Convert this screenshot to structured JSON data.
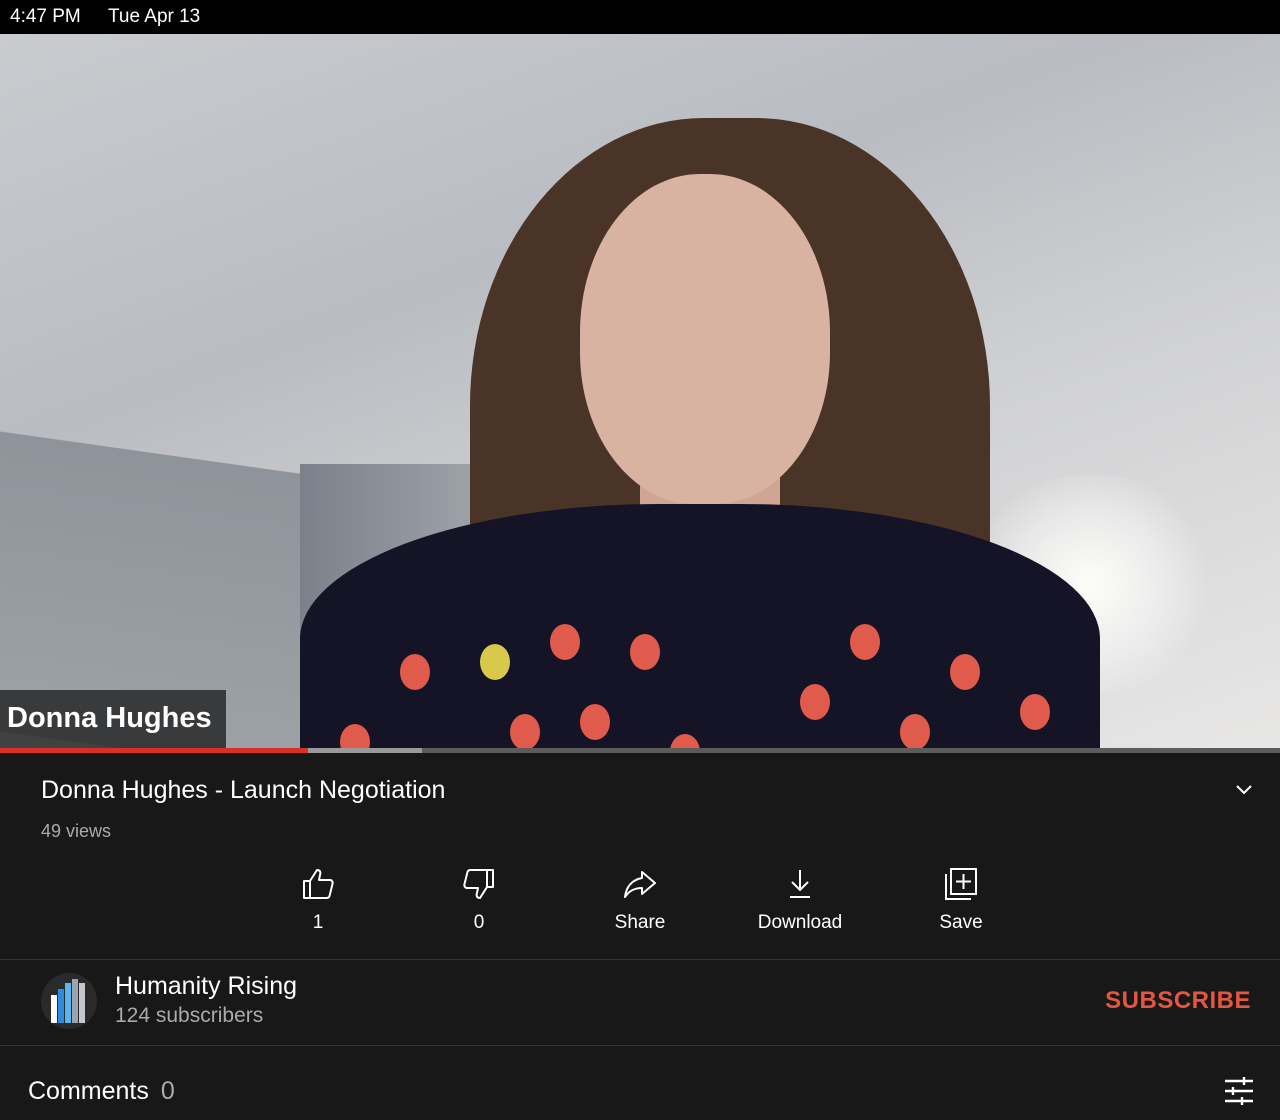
{
  "status_bar": {
    "time": "4:47 PM",
    "date": "Tue Apr 13"
  },
  "video": {
    "name_overlay": "Donna Hughes",
    "progress_played_fraction": 0.241,
    "progress_buffered_fraction": 0.33
  },
  "title": "Donna Hughes - Launch Negotiation",
  "views": "49 views",
  "actions": {
    "like": {
      "label": "1",
      "icon": "thumbs-up-icon"
    },
    "dislike": {
      "label": "0",
      "icon": "thumbs-down-icon"
    },
    "share": {
      "label": "Share",
      "icon": "share-arrow-icon"
    },
    "download": {
      "label": "Download",
      "icon": "download-icon"
    },
    "save": {
      "label": "Save",
      "icon": "add-to-playlist-icon"
    }
  },
  "channel": {
    "name": "Humanity Rising",
    "subscribers": "124 subscribers",
    "subscribe_label": "SUBSCRIBE",
    "subscribe_color": "#e5553f"
  },
  "comments": {
    "label": "Comments",
    "count": "0"
  },
  "colors": {
    "background": "#181818",
    "progress": "#d93025"
  }
}
